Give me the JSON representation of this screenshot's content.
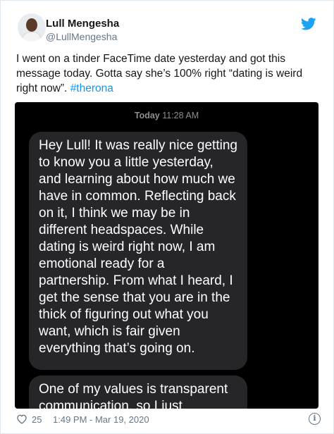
{
  "tweet": {
    "author_name": "Lull Mengesha",
    "author_handle": "@LullMengesha",
    "text": "I went on a tinder FaceTime date yesterday and got this message today. Gotta say she’s 100% right “dating is weird right now”.",
    "hashtag": "#therona",
    "likes": "25",
    "timestamp": "1:49 PM - Mar 19, 2020"
  },
  "media": {
    "time_day": "Today",
    "time_clock": "11:28 AM",
    "message_1": "Hey Lull! It was really nice getting to know you a little yesterday, and learning about how much we have in common. Reflecting back on it, I think we may be in different headspaces. While dating is weird right now, I am  emotional ready for a partnership. From what I heard, I get the sense that you are in the thick of figuring out what you want, which is fair given everything that’s going on.",
    "message_2": "One of my values is transparent communication, so I just"
  },
  "icons": {
    "brand": "twitter-bird-icon",
    "like": "heart-icon",
    "info": "info-icon"
  },
  "colors": {
    "link": "#1b95e0",
    "twitter_blue": "#1da1f2",
    "bubble": "#262629"
  }
}
